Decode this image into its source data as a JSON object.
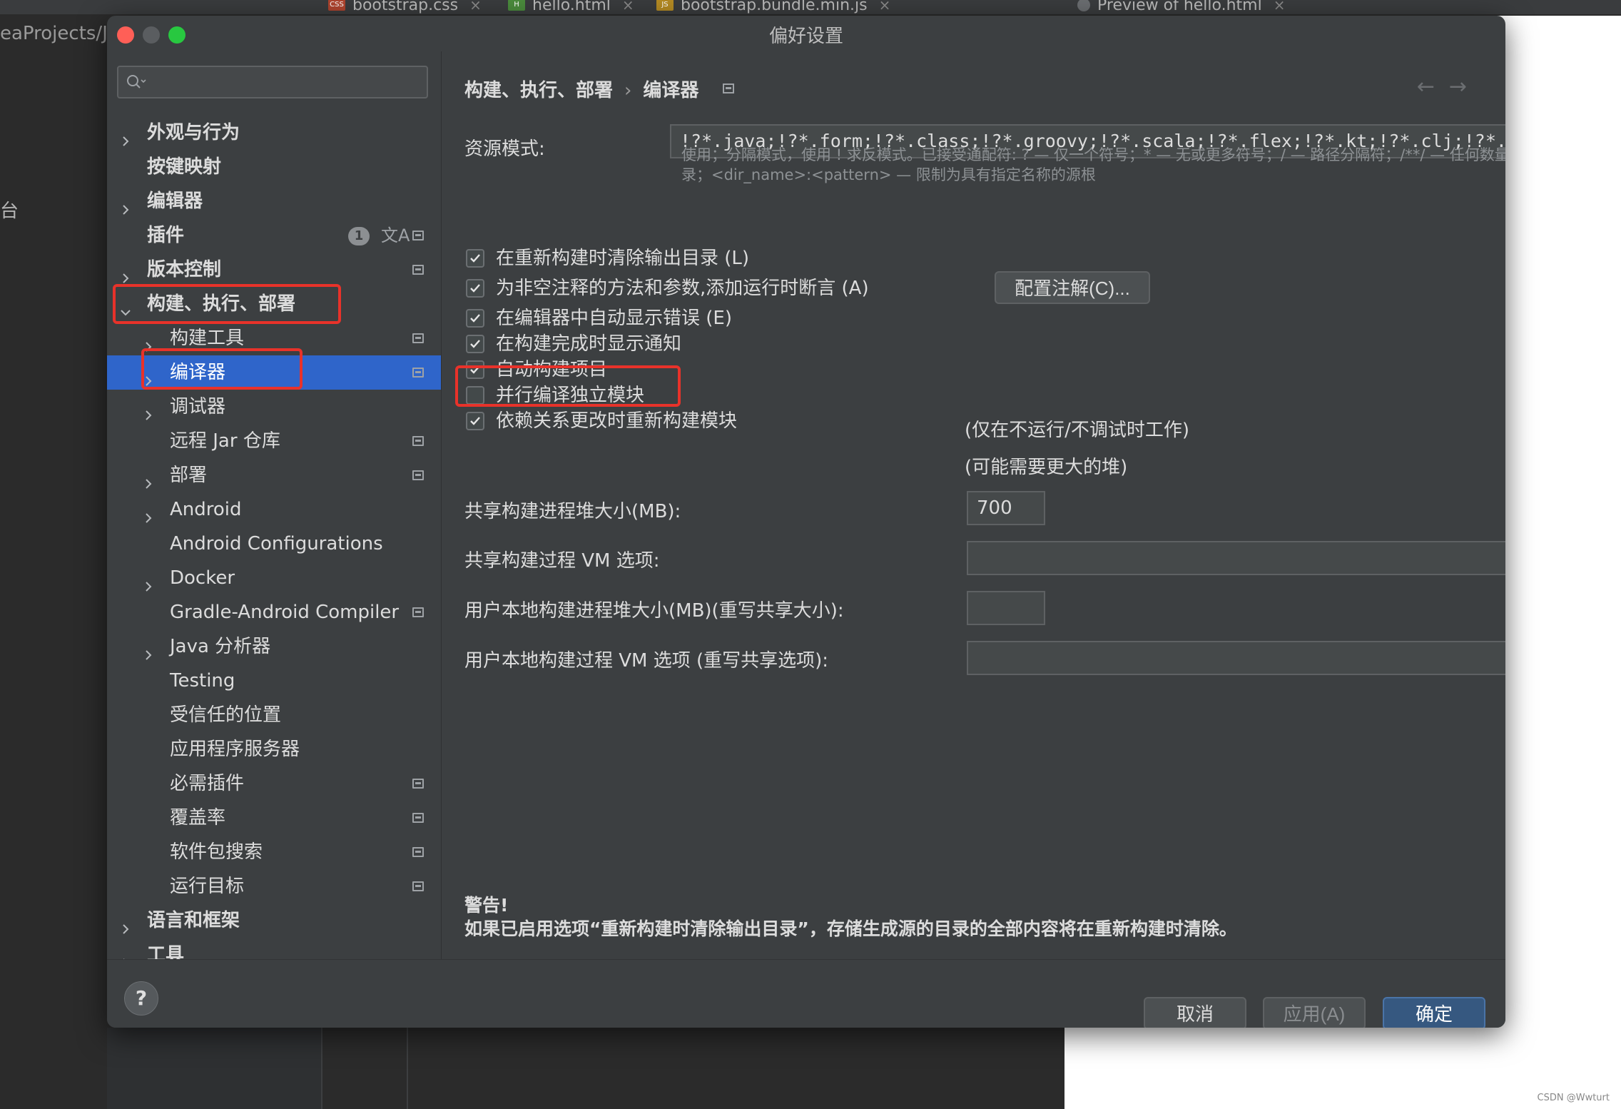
{
  "ide": {
    "tabs": [
      {
        "label": "bootstrap.css",
        "icon": "CSS"
      },
      {
        "label": "hello.html",
        "icon": "H"
      },
      {
        "label": "bootstrap.bundle.min.js",
        "icon": "JS"
      },
      {
        "label": "Preview of hello.html",
        "icon": "globe"
      }
    ],
    "path_fragment": "eaProjects/Ja",
    "side_char": "台",
    "watermark": "CSDN @Wwturt"
  },
  "dialog": {
    "title": "偏好设置",
    "search_placeholder": "",
    "sidebar": {
      "items": [
        {
          "label": "外观与行为",
          "bold": true,
          "chevron": "right",
          "indent": 0
        },
        {
          "label": "按键映射",
          "bold": true,
          "chevron": "none",
          "indent": 0
        },
        {
          "label": "编辑器",
          "bold": true,
          "chevron": "right",
          "indent": 0
        },
        {
          "label": "插件",
          "bold": true,
          "chevron": "none",
          "indent": 0,
          "badge": "1",
          "translate_icon": "文A"
        },
        {
          "label": "版本控制",
          "bold": true,
          "chevron": "right",
          "indent": 0,
          "settings_icon": true
        },
        {
          "label": "构建、执行、部署",
          "bold": true,
          "chevron": "down",
          "indent": 0
        },
        {
          "label": "构建工具",
          "bold": false,
          "chevron": "right",
          "indent": 1,
          "settings_icon": true
        },
        {
          "label": "编译器",
          "bold": false,
          "chevron": "right",
          "indent": 1,
          "settings_icon": true,
          "selected": true
        },
        {
          "label": "调试器",
          "bold": false,
          "chevron": "right",
          "indent": 1
        },
        {
          "label": "远程 Jar 仓库",
          "bold": false,
          "chevron": "none",
          "indent": 1,
          "settings_icon": true
        },
        {
          "label": "部署",
          "bold": false,
          "chevron": "right",
          "indent": 1,
          "settings_icon": true
        },
        {
          "label": "Android",
          "bold": false,
          "chevron": "right",
          "indent": 1
        },
        {
          "label": "Android Configurations",
          "bold": false,
          "chevron": "none",
          "indent": 1
        },
        {
          "label": "Docker",
          "bold": false,
          "chevron": "right",
          "indent": 1
        },
        {
          "label": "Gradle-Android Compiler",
          "bold": false,
          "chevron": "none",
          "indent": 1,
          "settings_icon": true
        },
        {
          "label": "Java 分析器",
          "bold": false,
          "chevron": "right",
          "indent": 1
        },
        {
          "label": "Testing",
          "bold": false,
          "chevron": "none",
          "indent": 1
        },
        {
          "label": "受信任的位置",
          "bold": false,
          "chevron": "none",
          "indent": 1
        },
        {
          "label": "应用程序服务器",
          "bold": false,
          "chevron": "none",
          "indent": 1
        },
        {
          "label": "必需插件",
          "bold": false,
          "chevron": "none",
          "indent": 1,
          "settings_icon": true
        },
        {
          "label": "覆盖率",
          "bold": false,
          "chevron": "none",
          "indent": 1,
          "settings_icon": true
        },
        {
          "label": "软件包搜索",
          "bold": false,
          "chevron": "none",
          "indent": 1,
          "settings_icon": true
        },
        {
          "label": "运行目标",
          "bold": false,
          "chevron": "none",
          "indent": 1,
          "settings_icon": true
        },
        {
          "label": "语言和框架",
          "bold": true,
          "chevron": "right",
          "indent": 0
        },
        {
          "label": "工具",
          "bold": true,
          "chevron": "right",
          "indent": 0
        }
      ]
    },
    "breadcrumb": {
      "parent": "构建、执行、部署",
      "separator": "›",
      "current": "编译器"
    },
    "nav": {
      "back": "←",
      "forward": "→"
    },
    "resource_patterns": {
      "label": "资源模式:",
      "value": "!?*.java;!?*.form;!?*.class;!?*.groovy;!?*.scala;!?*.flex;!?*.kt;!?*.clj;!?*.a",
      "hint_line1": "使用；分隔模式，使用 ! 求反模式。已接受通配符: ? — 仅一个符号；* — 无或更多符号；/ — 路径分隔符；/**/ — 任何数量的目",
      "hint_line2": "录；<dir_name>:<pattern> — 限制为具有指定名称的源根"
    },
    "options": [
      {
        "label": "在重新构建时清除输出目录 (L)",
        "checked": true
      },
      {
        "label": "为非空注释的方法和参数,添加运行时断言 (A)",
        "checked": true,
        "button": "配置注解(C)..."
      },
      {
        "label": "在编辑器中自动显示错误 (E)",
        "checked": true
      },
      {
        "label": "在构建完成时显示通知",
        "checked": true
      },
      {
        "label": "自动构建项目",
        "checked": true,
        "note": "(仅在不运行/不调试时工作)"
      },
      {
        "label": "并行编译独立模块",
        "checked": false,
        "note": "(可能需要更大的堆)"
      },
      {
        "label": "依赖关系更改时重新构建模块",
        "checked": true
      }
    ],
    "fields": [
      {
        "label": "共享构建进程堆大小(MB):",
        "value": "700"
      },
      {
        "label": "共享构建过程 VM 选项:",
        "value": ""
      },
      {
        "label": "用户本地构建进程堆大小(MB)(重写共享大小):",
        "value": ""
      },
      {
        "label": "用户本地构建过程 VM 选项 (重写共享选项):",
        "value": ""
      }
    ],
    "warning": {
      "title": "警告!",
      "text": "如果已启用选项“重新构建时清除输出目录”，存储生成源的目录的全部内容将在重新构建时清除。"
    },
    "footer": {
      "help": "?",
      "cancel": "取消",
      "apply": "应用(A)",
      "ok": "确定"
    },
    "colors": {
      "selection": "#2f65ca",
      "annotation": "#e8322a",
      "primary_button": "#365880"
    }
  }
}
